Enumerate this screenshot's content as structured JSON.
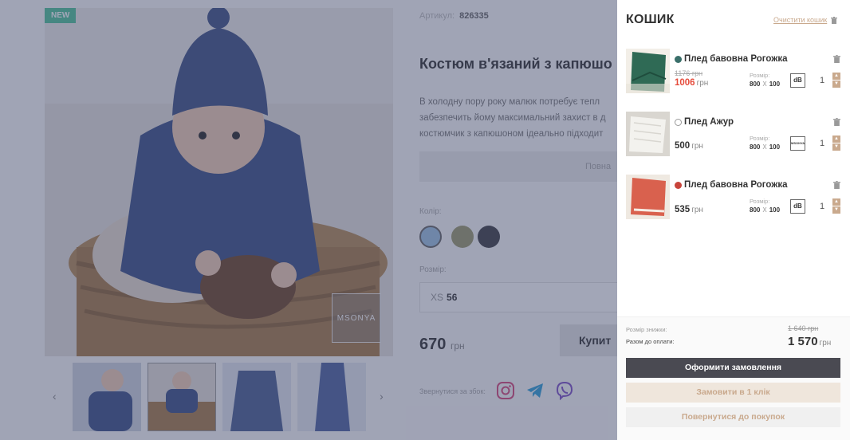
{
  "product": {
    "badge": "NEW",
    "brand_mark": "MSONYA",
    "article_label": "Артикул:",
    "article_value": "826335",
    "title": "Костюм в'язаний з капюшо",
    "description_lines": [
      "В холодну пору року малюк потребує тепл",
      "забезпечить йому максимальний захист в д",
      "костюмчик з капюшоном ідеально підходит"
    ],
    "table_button": "Повна",
    "color_label": "Колір:",
    "colors": [
      "#9dc2e2",
      "#9b9a6e",
      "#3e3f44"
    ],
    "size_label": "Розмір:",
    "size_value_prefix": "XS",
    "size_value": "56",
    "price": "670",
    "currency": "грн",
    "buy_label": "Купит",
    "share_label": "Звернутися за збок:",
    "prev_arrow": "‹",
    "next_arrow": "›",
    "social_icons": [
      "instagram-icon",
      "telegram-icon",
      "viber-icon"
    ]
  },
  "cart": {
    "title": "КОШИК",
    "clear_label": "Очистити кошик",
    "size_label": "Розмір:",
    "items": [
      {
        "name": "Плед бавовна Рогожка",
        "dot_color": "#3a6f6a",
        "old_price": "1176 грн",
        "price": "1006",
        "currency": "грн",
        "on_sale": true,
        "size_w": "800",
        "size_x": "X",
        "size_h": "100",
        "logo": "dB",
        "qty": "1",
        "image_color": "#2f6a55"
      },
      {
        "name": "Плед Ажур",
        "dot_color": "#ffffff",
        "old_price": "",
        "price": "500",
        "currency": "грн",
        "on_sale": false,
        "size_w": "800",
        "size_x": "X",
        "size_h": "100",
        "logo": "MSONYA",
        "qty": "1",
        "image_color": "#e9e9e7"
      },
      {
        "name": "Плед бавовна Рогожка",
        "dot_color": "#c8443b",
        "old_price": "",
        "price": "535",
        "currency": "грн",
        "on_sale": false,
        "size_w": "800",
        "size_x": "X",
        "size_h": "100",
        "logo": "dB",
        "qty": "1",
        "image_color": "#d9614e"
      }
    ],
    "discount_label": "Розмір знижки:",
    "discount_value": "1 640 грн",
    "total_label": "Разом до оплати:",
    "total_value": "1 570",
    "total_currency": "грн",
    "checkout_label": "Оформити замовлення",
    "oneclick_label": "Замовити в 1 клік",
    "back_label": "Повернутися до покупок"
  }
}
